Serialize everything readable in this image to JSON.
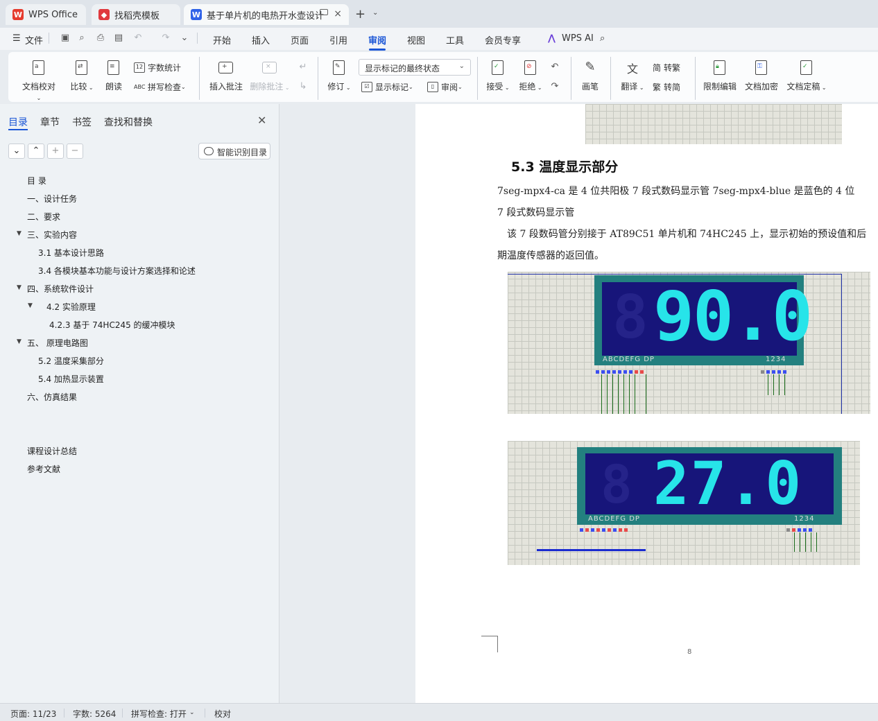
{
  "tabs": {
    "wps": "WPS Office",
    "template": "找稻壳模板",
    "document": "基于单片机的电热开水壶设计"
  },
  "menu": {
    "file": "文件",
    "items": [
      "开始",
      "插入",
      "页面",
      "引用",
      "审阅",
      "视图",
      "工具",
      "会员专享"
    ],
    "active": "审阅",
    "wps_ai": "WPS AI"
  },
  "ribbon": {
    "proofread": "文档校对",
    "compare": "比较",
    "read_aloud": "朗读",
    "word_count": "字数统计",
    "spell_check": "拼写检查",
    "insert_comment": "插入批注",
    "delete_comment": "删除批注",
    "revise": "修订",
    "markup_state": "显示标记的最终状态",
    "show_markup": "显示标记",
    "review": "审阅",
    "accept": "接受",
    "reject": "拒绝",
    "brush": "画笔",
    "translate": "翻译",
    "to_traditional": "转繁",
    "to_simplified": "转简",
    "restrict_edit": "限制编辑",
    "encrypt": "文档加密",
    "finalize": "文档定稿"
  },
  "sidebar": {
    "tabs": [
      "目录",
      "章节",
      "书签",
      "查找和替换"
    ],
    "smart_toc": "智能识别目录",
    "toc": [
      "目  录",
      "一、设计任务",
      "二、要求",
      "三、实验内容",
      "3.1 基本设计思路",
      "3.4 各模块基本功能与设计方案选择和论述",
      "四、系统软件设计",
      "4.2 实验原理",
      "4.2.3 基于 74HC245 的缓冲模块",
      "五、  原理电路图",
      "5.2 温度采集部分",
      "5.4 加热显示装置",
      "六、仿真结果",
      "课程设计总结",
      "参考文献"
    ]
  },
  "document": {
    "heading": "5.3 温度显示部分",
    "para1_line1": "7seg-mpx4-ca 是 4 位共阳极 7 段式数码显示管 7seg-mpx4-blue 是蓝色的 4 位",
    "para1_line2": "7 段式数码显示管",
    "para2_line1": "该 7 段数码管分别接于 AT89C51 单片机和 74HC245 上，显示初始的预设值和后",
    "para2_line2": "期温度传感器的返回值。",
    "display1_value": "90.0",
    "display2_value": "27.0",
    "seg_label": "ABCDEFG  DP",
    "digit_label": "1234",
    "page_number": "8"
  },
  "status": {
    "page": "页面: 11/23",
    "words": "字数: 5264",
    "spell": "拼写检查: 打开",
    "proof": "校对"
  },
  "colors": {
    "accent": "#1a55d6",
    "lcd_frame": "#23807f",
    "lcd_face": "#17157a",
    "lcd_digit": "#27e4e9"
  }
}
